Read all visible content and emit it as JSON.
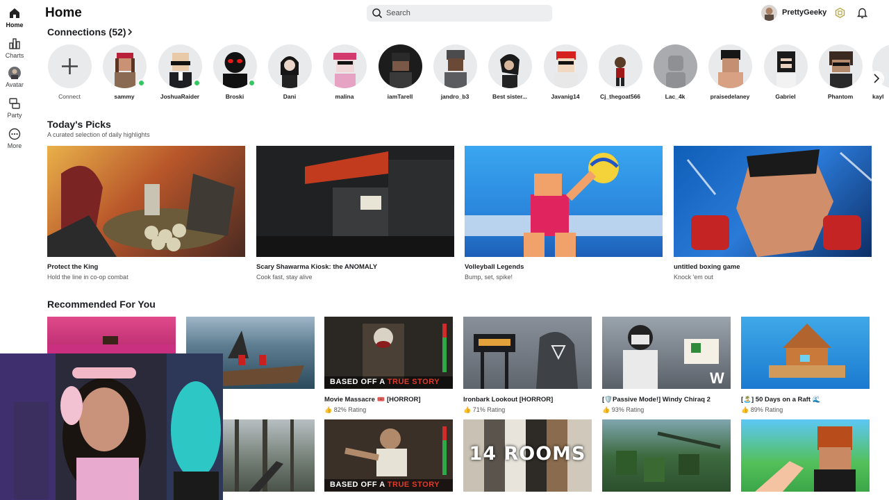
{
  "nav": {
    "items": [
      {
        "label": "Home",
        "icon": "home-icon"
      },
      {
        "label": "Charts",
        "icon": "charts-icon"
      },
      {
        "label": "Avatar",
        "icon": "avatar-icon"
      },
      {
        "label": "Party",
        "icon": "party-icon"
      },
      {
        "label": "More",
        "icon": "more-icon"
      }
    ]
  },
  "header": {
    "title": "Home",
    "search_placeholder": "Search",
    "username": "PrettyGeeky"
  },
  "connections": {
    "title": "Connections (52)",
    "connect_label": "Connect",
    "friends": [
      {
        "name": "sammy",
        "online": true
      },
      {
        "name": "JoshuaRaider",
        "online": true
      },
      {
        "name": "Broski",
        "online": true
      },
      {
        "name": "Dani",
        "online": false
      },
      {
        "name": "malina",
        "online": false
      },
      {
        "name": "iamTarell",
        "online": false
      },
      {
        "name": "jandro_b3",
        "online": false
      },
      {
        "name": "Best sister...",
        "online": false
      },
      {
        "name": "Javanig14",
        "online": false
      },
      {
        "name": "Cj_thegoat566",
        "online": false
      },
      {
        "name": "Lac_4k",
        "online": false
      },
      {
        "name": "praisedelaney",
        "online": false
      },
      {
        "name": "Gabriel",
        "online": false
      },
      {
        "name": "Phantom",
        "online": false
      },
      {
        "name": "kayl",
        "online": false
      }
    ]
  },
  "picks": {
    "title": "Today's Picks",
    "subtitle": "A curated selection of daily highlights",
    "items": [
      {
        "title": "Protect the King",
        "desc": "Hold the line in co-op combat"
      },
      {
        "title": "Scary Shawarma Kiosk: the ANOMALY",
        "desc": "Cook fast, stay alive"
      },
      {
        "title": "Volleyball Legends",
        "desc": "Bump, set, spike!"
      },
      {
        "title": "untitled boxing game",
        "desc": "Knock 'em out"
      }
    ]
  },
  "recommended": {
    "title": "Recommended For You",
    "row1": [
      {
        "title": "",
        "rating": ""
      },
      {
        "title": "OAT TRIP",
        "rating": "g"
      },
      {
        "title": "Movie Massacre 🎟️ [HORROR]",
        "rating": "82% Rating",
        "banner_a": "BASED OFF A ",
        "banner_b": "TRUE STORY"
      },
      {
        "title": "Ironbark Lookout [HORROR]",
        "rating": "71% Rating"
      },
      {
        "title": "[🛡️Passive Mode!] Windy Chiraq 2",
        "rating": "93% Rating"
      },
      {
        "title": "[🏝️] 50 Days on a Raft 🌊",
        "rating": "89% Rating"
      }
    ],
    "row2": [
      {
        "banner_a": "BASED OFF A ",
        "banner_b": "TRUE STORY"
      },
      {
        "thumb_text": "14 ROOMS"
      }
    ]
  },
  "colors": {
    "online": "#36c760",
    "banner_red": "#e23a2a"
  }
}
